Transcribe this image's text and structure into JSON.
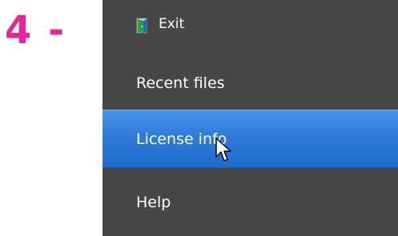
{
  "step": {
    "label": "4 -",
    "color": "#e0289a"
  },
  "menu": {
    "background": "#474747",
    "items": [
      {
        "label": "Exit",
        "icon": "exit-door-icon",
        "selected": false
      },
      {
        "label": "Recent files",
        "selected": false
      },
      {
        "label": "License info",
        "selected": true
      },
      {
        "label": "Help",
        "selected": false
      }
    ]
  },
  "colors": {
    "highlight": "#2f7bd9",
    "text": "#ffffff"
  },
  "cursor": "mouse-pointer-icon"
}
